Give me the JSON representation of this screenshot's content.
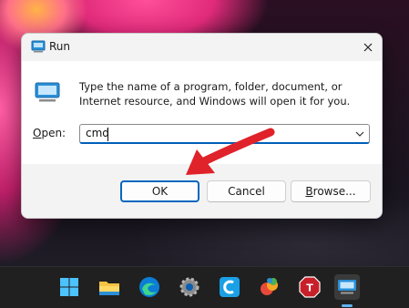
{
  "dialog": {
    "title": "Run",
    "description": "Type the name of a program, folder, document, or Internet resource, and Windows will open it for you.",
    "open_label_underlined": "O",
    "open_label_rest": "pen:",
    "command_value": "cmd",
    "ok_label": "OK",
    "cancel_label": "Cancel",
    "browse_label_underlined": "B",
    "browse_label_rest": "rowse..."
  },
  "taskbar": {
    "icons": [
      "windows-start-icon",
      "file-explorer-icon",
      "edge-icon",
      "settings-icon",
      "ccleaner-icon",
      "paint-app-icon",
      "stop-app-icon",
      "run-app-icon"
    ]
  },
  "colors": {
    "accent": "#0067c0",
    "annotation_arrow": "#e0222a"
  }
}
